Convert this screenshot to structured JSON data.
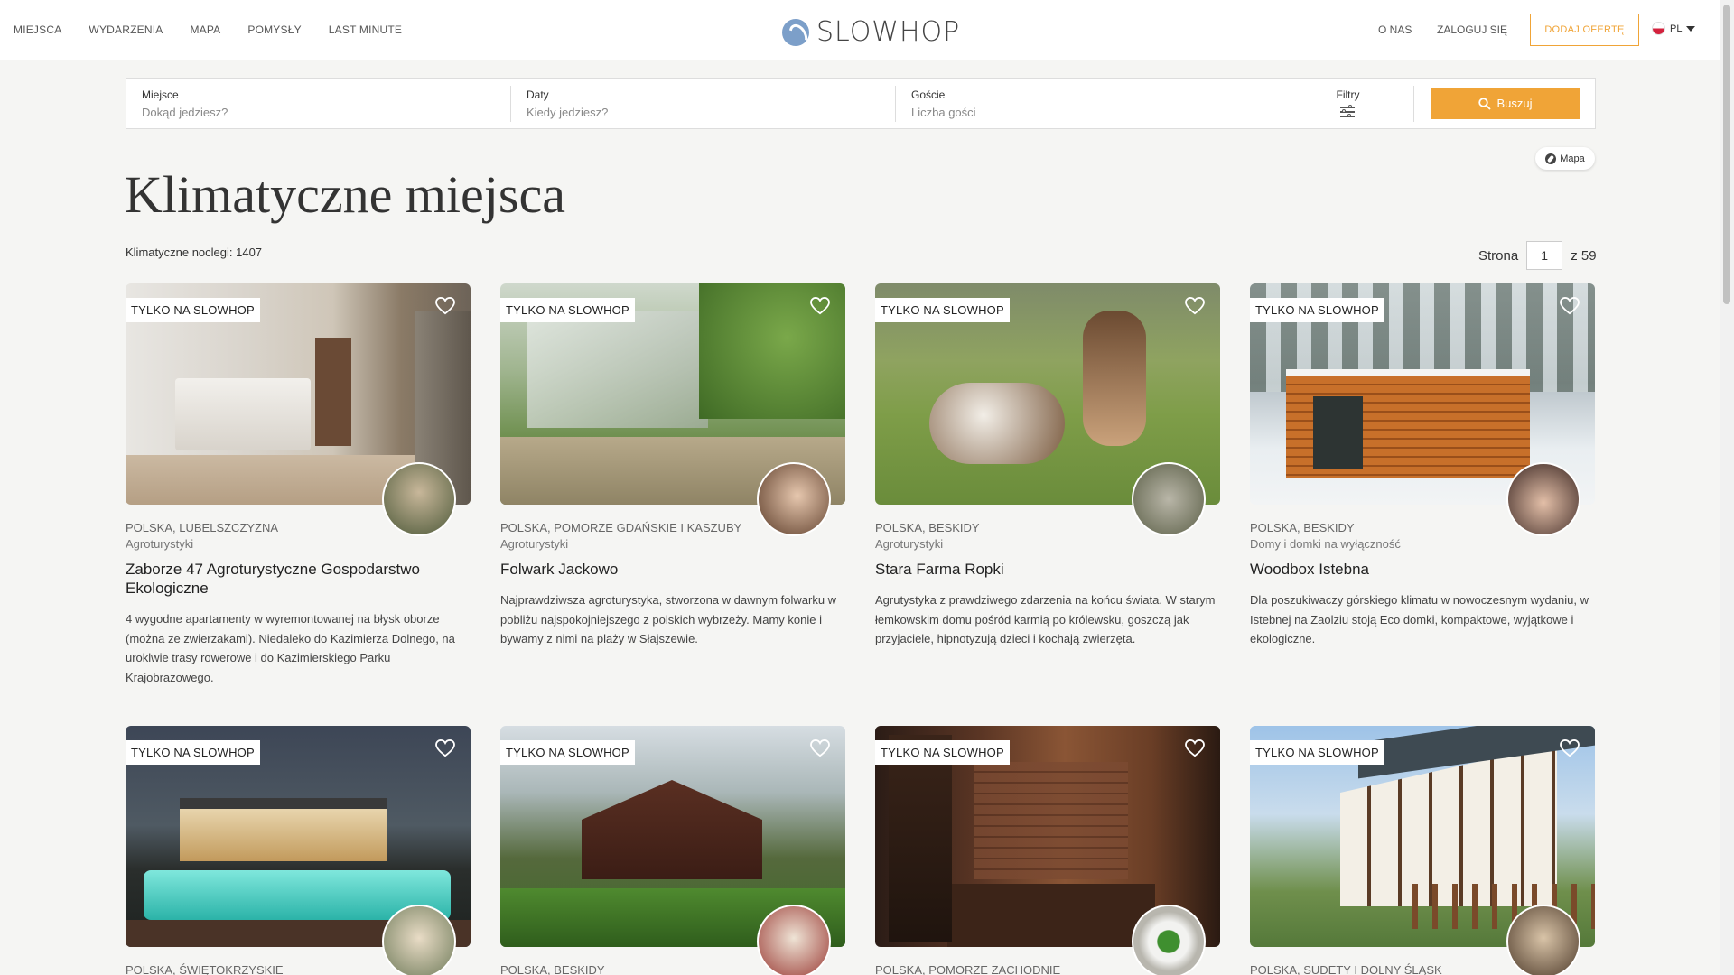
{
  "nav": {
    "left": [
      "MIEJSCA",
      "WYDARZENIA",
      "MAPA",
      "POMYSŁY",
      "LAST MINUTE"
    ],
    "logo": "SLOWHOP",
    "about": "O NAS",
    "login": "ZALOGUJ SIĘ",
    "add_offer": "DODAJ OFERTĘ",
    "lang": "PL"
  },
  "search": {
    "place_label": "Miejsce",
    "place_placeholder": "Dokąd jedziesz?",
    "dates_label": "Daty",
    "dates_placeholder": "Kiedy jedziesz?",
    "guests_label": "Goście",
    "guests_placeholder": "Liczba gości",
    "filters_label": "Filtry",
    "search_button": "Buszuj"
  },
  "map_button": "Mapa",
  "page": {
    "title": "Klimatyczne miejsca",
    "count_text": "Klimatyczne noclegi: 1407",
    "pager_label": "Strona",
    "pager_value": "1",
    "pager_total": "z 59"
  },
  "colors": {
    "accent": "#f0a437",
    "background": "#f5f5f3"
  },
  "cards": [
    {
      "badge": "TYLKO NA SLOWHOP",
      "location": "POLSKA, LUBELSZCZYZNA",
      "category": "Agroturystyki",
      "name": "Zaborze 47 Agroturystyczne Gospodarstwo Ekologiczne",
      "description": "4 wygodne apartamenty w wyremontowanej na błysk oborze (można ze zwierzakami). Niedaleko do Kazimierza Dolnego, na uroklwie trasy rowerowe i do Kazimierskiego Parku Krajobrazowego."
    },
    {
      "badge": "TYLKO NA SLOWHOP",
      "location": "POLSKA, POMORZE GDAŃSKIE I KASZUBY",
      "category": "Agroturystyki",
      "name": "Folwark Jackowo",
      "description": "Najprawdziwsza agroturystyka, stworzona w dawnym folwarku w pobliżu najspokojniejszego z polskich wybrzeży. Mamy konie i bywamy z nimi na plaży w Słajszewie."
    },
    {
      "badge": "TYLKO NA SLOWHOP",
      "location": "POLSKA, BESKIDY",
      "category": "Agroturystyki",
      "name": "Stara Farma Ropki",
      "description": "Agrutystyka z prawdziwego zdarzenia na końcu świata. W starym łemkowskim domu pośród karmią po królewsku, goszczą jak przyjaciele, hipnotyzują dzieci i kochają zwierzęta."
    },
    {
      "badge": "TYLKO NA SLOWHOP",
      "location": "POLSKA, BESKIDY",
      "category": "Domy i domki na wyłączność",
      "name": "Woodbox Istebna",
      "description": "Dla poszukiwaczy górskiego klimatu w nowoczesnym wydaniu, w Istebnej na Zaolziu stoją Eco domki, kompaktowe, wyjątkowe i ekologiczne."
    },
    {
      "badge": "TYLKO NA SLOWHOP",
      "location": "POLSKA, ŚWIĘTOKRZYSKIE"
    },
    {
      "badge": "TYLKO NA SLOWHOP",
      "location": "POLSKA, BESKIDY"
    },
    {
      "badge": "TYLKO NA SLOWHOP",
      "location": "POLSKA, POMORZE ZACHODNIE"
    },
    {
      "badge": "TYLKO NA SLOWHOP",
      "location": "POLSKA, SUDETY I DOLNY ŚLĄSK"
    }
  ]
}
